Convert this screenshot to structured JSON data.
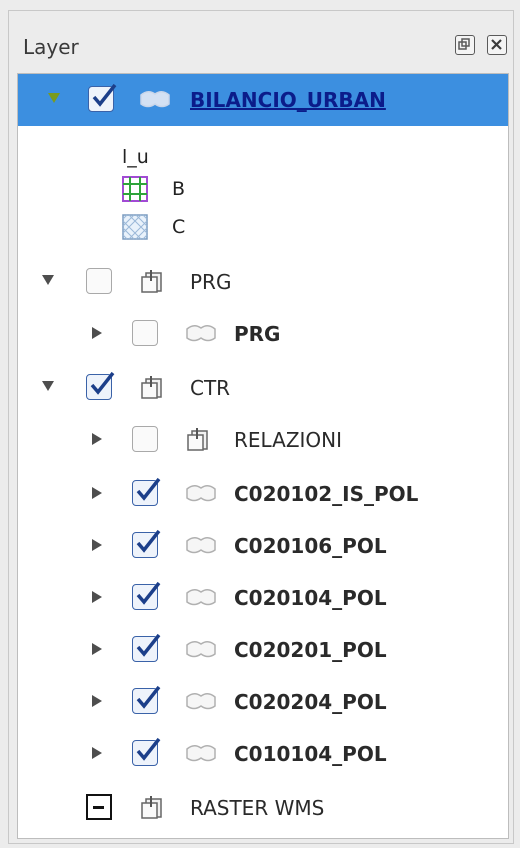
{
  "panel": {
    "title": "Layer"
  },
  "tree": {
    "root": {
      "label": "BILANCIO_URBAN"
    },
    "legend": [
      {
        "label": "l_u"
      },
      {
        "label": "B",
        "symbol": "green-grid-purple-border"
      },
      {
        "label": "C",
        "symbol": "blue-crosshatch"
      }
    ],
    "groups": {
      "prg": {
        "label": "PRG",
        "child": {
          "label": "PRG"
        }
      },
      "ctr": {
        "label": "CTR",
        "children": [
          {
            "label": "RELAZIONI",
            "kind": "group",
            "checked": false
          },
          {
            "label": "C020102_IS_POL",
            "kind": "layer",
            "checked": true
          },
          {
            "label": "C020106_POL",
            "kind": "layer",
            "checked": true
          },
          {
            "label": "C020104_POL",
            "kind": "layer",
            "checked": true
          },
          {
            "label": "C020201_POL",
            "kind": "layer",
            "checked": true
          },
          {
            "label": "C020204_POL",
            "kind": "layer",
            "checked": true
          },
          {
            "label": "C010104_POL",
            "kind": "layer",
            "checked": true
          }
        ]
      },
      "raster": {
        "label": "RASTER WMS"
      }
    }
  },
  "colors": {
    "selection": "#3c8fe0",
    "checkbox_checked": "#3a62a8",
    "selected_text": "#0b1c8a"
  }
}
